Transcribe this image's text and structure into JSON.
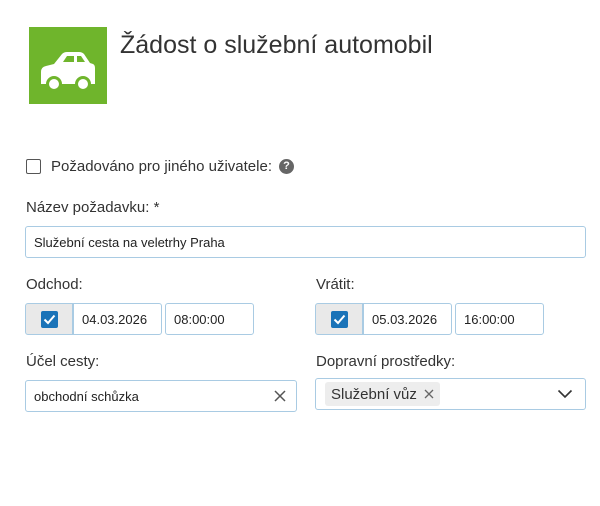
{
  "header": {
    "title": "Žádost o služební automobil",
    "icon": "car-icon",
    "icon_bg": "#6fb52c"
  },
  "other_user": {
    "label": "Požadováno pro jiného uživatele:",
    "help": "?",
    "checked": false
  },
  "request_name": {
    "label": "Název požadavku: *",
    "value": "Služební cesta na veletrhy Praha"
  },
  "departure": {
    "label": "Odchod:",
    "checked": true,
    "date": "04.03.2026",
    "time": "08:00:00"
  },
  "return": {
    "label": "Vrátit:",
    "checked": true,
    "date": "05.03.2026",
    "time": "16:00:00"
  },
  "purpose": {
    "label": "Účel cesty:",
    "value": "obchodní schůzka"
  },
  "transport": {
    "label": "Dopravní prostředky:",
    "selected": [
      "Služební vůz"
    ]
  },
  "colors": {
    "accent": "#1a73b8",
    "input_border": "#a9cbe3"
  }
}
